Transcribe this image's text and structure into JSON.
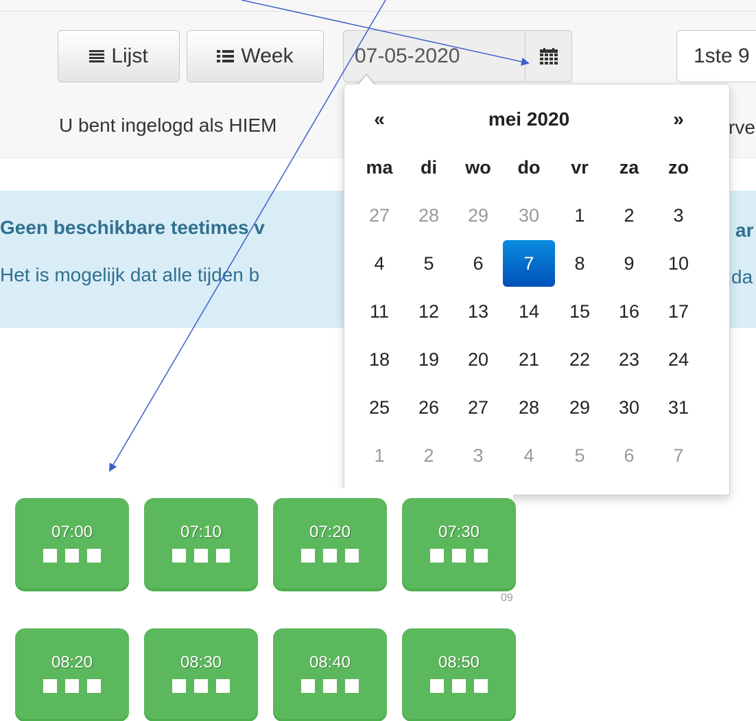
{
  "toolbar": {
    "list_label": "Lijst",
    "week_label": "Week",
    "date_value": "07-05-2020",
    "course_select_value": "1ste 9",
    "list_icon": "list-icon",
    "week_icon": "week-list-icon",
    "calendar_icon": "calendar-icon"
  },
  "header": {
    "login_text": "U bent ingelogd als HIEM",
    "right_cut": "rve"
  },
  "alert": {
    "title": "Geen beschikbare teetimes v",
    "body": "Het is mogelijk dat alle tijden b",
    "title_cut": "ar",
    "body_cut": "da"
  },
  "datepicker": {
    "prev": "«",
    "next": "»",
    "month": "mei 2020",
    "weekdays": [
      "ma",
      "di",
      "wo",
      "do",
      "vr",
      "za",
      "zo"
    ],
    "weeks": [
      [
        "27",
        "28",
        "29",
        "30",
        "1",
        "2",
        "3"
      ],
      [
        "4",
        "5",
        "6",
        "7",
        "8",
        "9",
        "10"
      ],
      [
        "11",
        "12",
        "13",
        "14",
        "15",
        "16",
        "17"
      ],
      [
        "18",
        "19",
        "20",
        "21",
        "22",
        "23",
        "24"
      ],
      [
        "25",
        "26",
        "27",
        "28",
        "29",
        "30",
        "31"
      ],
      [
        "1",
        "2",
        "3",
        "4",
        "5",
        "6",
        "7"
      ]
    ],
    "selected_day": "7"
  },
  "teetimes": {
    "row1": [
      "07:00",
      "07:10",
      "07:20",
      "07:30"
    ],
    "row2": [
      "08:20",
      "08:30",
      "08:40",
      "08:50"
    ],
    "cut_label": "09"
  },
  "colors": {
    "slot_green": "#5cb85c",
    "selected_blue": "#0a6fd0",
    "alert_bg": "#d9edf7",
    "arrow": "#3a5fc8"
  }
}
